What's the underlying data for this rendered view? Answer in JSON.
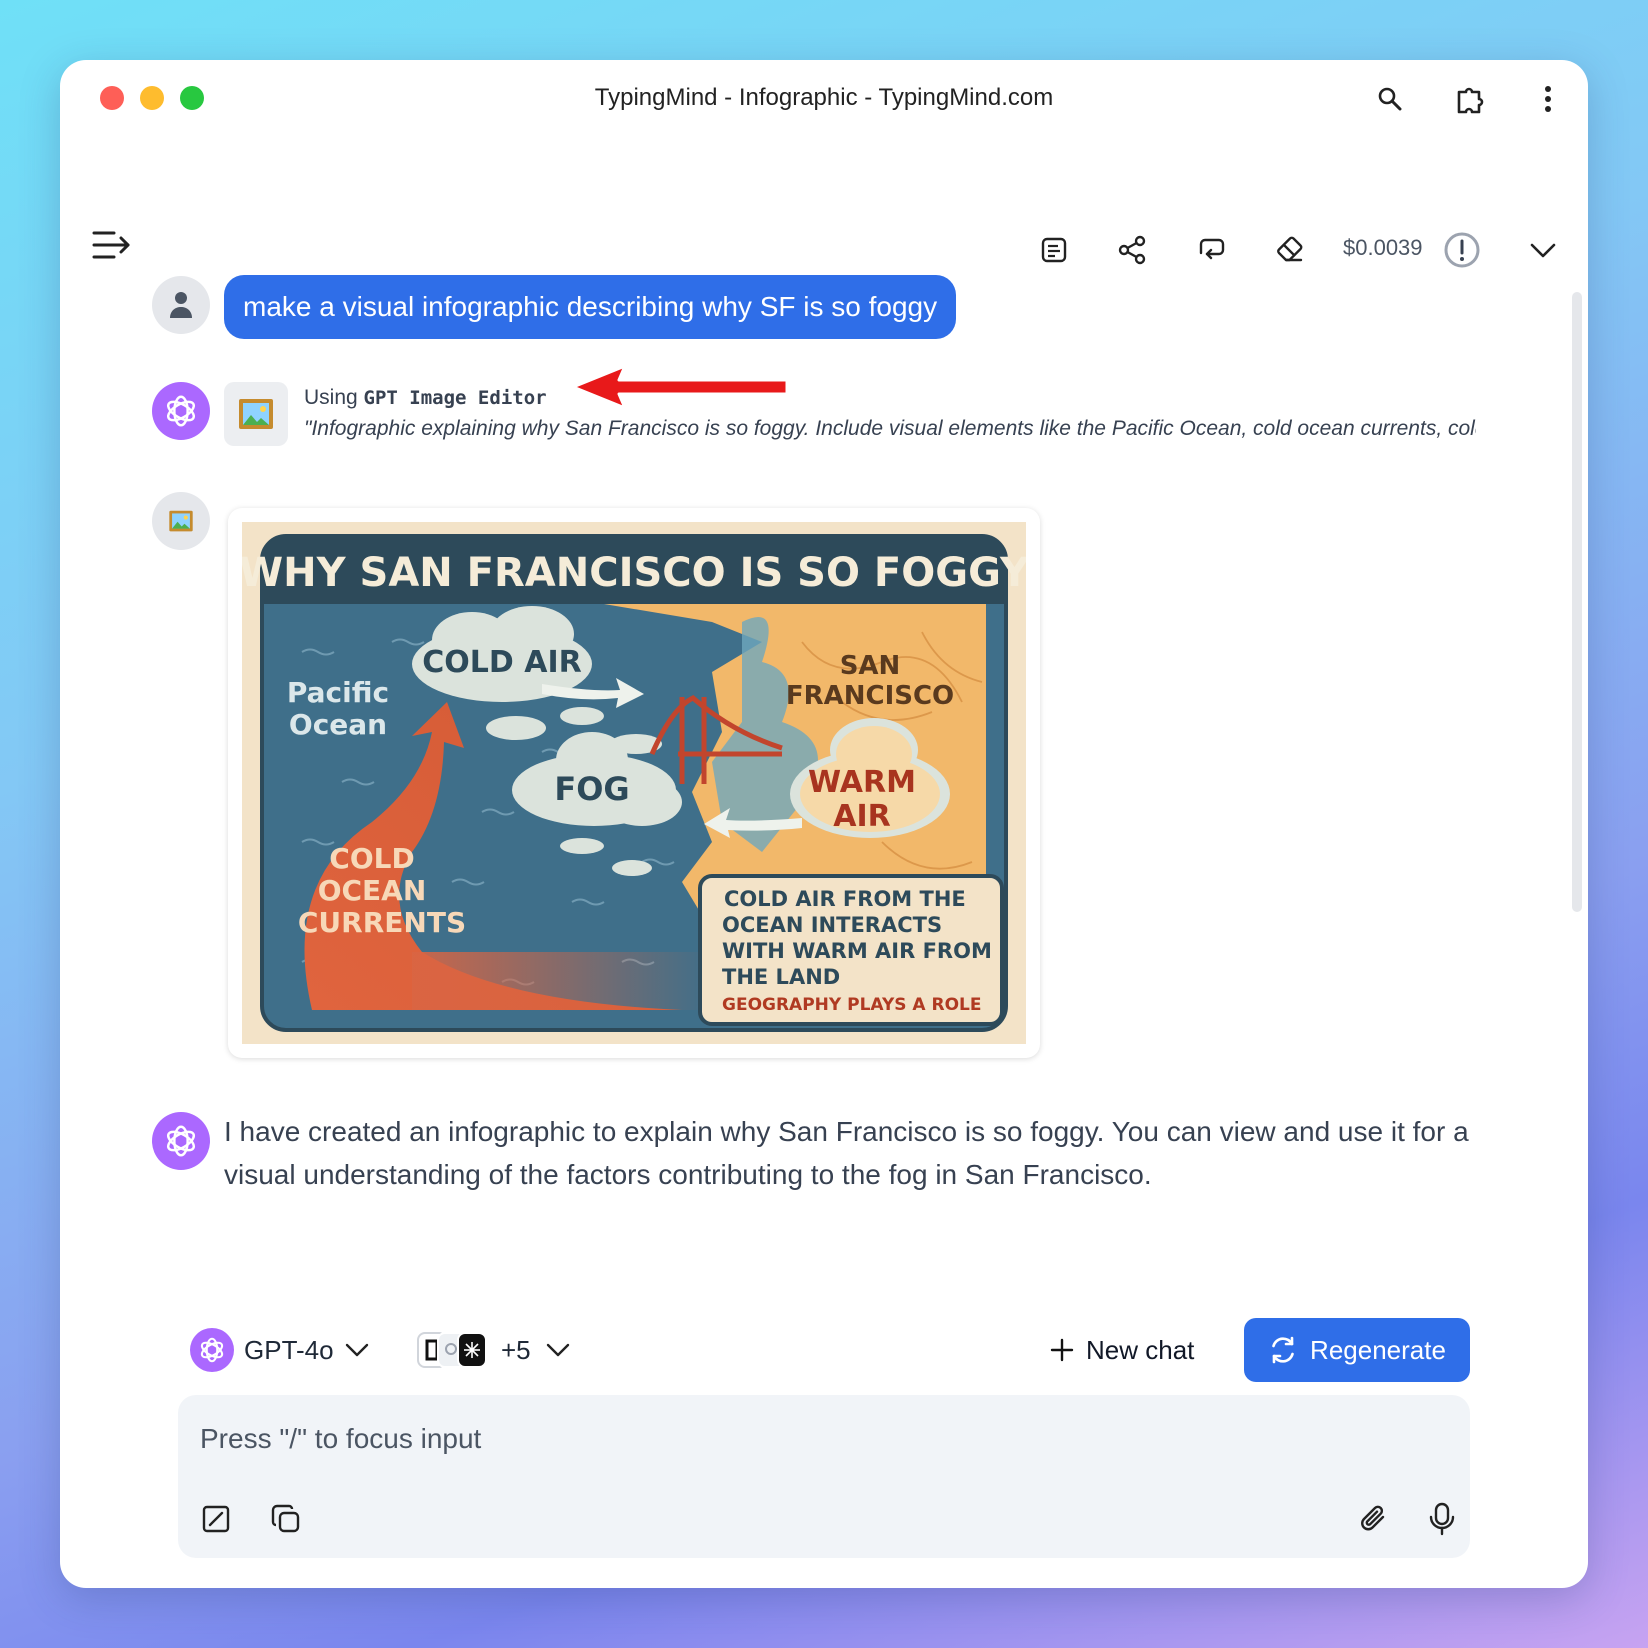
{
  "window": {
    "title": "TypingMind - Infographic - TypingMind.com"
  },
  "toolbar": {
    "cost": "$0.0039"
  },
  "messages": {
    "user_prompt": "make a visual infographic describing why SF is so foggy",
    "tool_using_prefix": "Using",
    "tool_name": "GPT Image Editor",
    "tool_prompt": "\"Infographic explaining why San Francisco is so foggy. Include visual elements like the Pacific Ocean, cold ocean currents, cold air, warm air and fog.\"",
    "assistant_reply": "I have created an infographic to explain why San Francisco is so foggy. You can view and use it for a visual understanding of the factors contributing to the fog in San Francisco."
  },
  "infographic": {
    "title": "WHY SAN FRANCISCO IS SO FOGGY",
    "pacific_1": "Pacific",
    "pacific_2": "Ocean",
    "cold_air": "COLD AIR",
    "fog": "FOG",
    "sf_1": "SAN",
    "sf_2": "FRANCISCO",
    "warm_1": "WARM",
    "warm_2": "AIR",
    "currents_1": "COLD",
    "currents_2": "OCEAN",
    "currents_3": "CURRENTS",
    "caption_1": "COLD AIR FROM THE",
    "caption_2": "OCEAN INTERACTS",
    "caption_3": "WITH WARM AIR FROM",
    "caption_4": "THE LAND",
    "caption_5": "GEOGRAPHY PLAYS A ROLE"
  },
  "composer": {
    "model": "GPT-4o",
    "plugin_more": "+5",
    "new_chat": "New chat",
    "regenerate": "Regenerate",
    "placeholder": "Press \"/\" to focus input"
  },
  "colors": {
    "accent": "#2f6ee8",
    "gpt": "#ab68ff",
    "annotation_arrow": "#e8191a"
  }
}
